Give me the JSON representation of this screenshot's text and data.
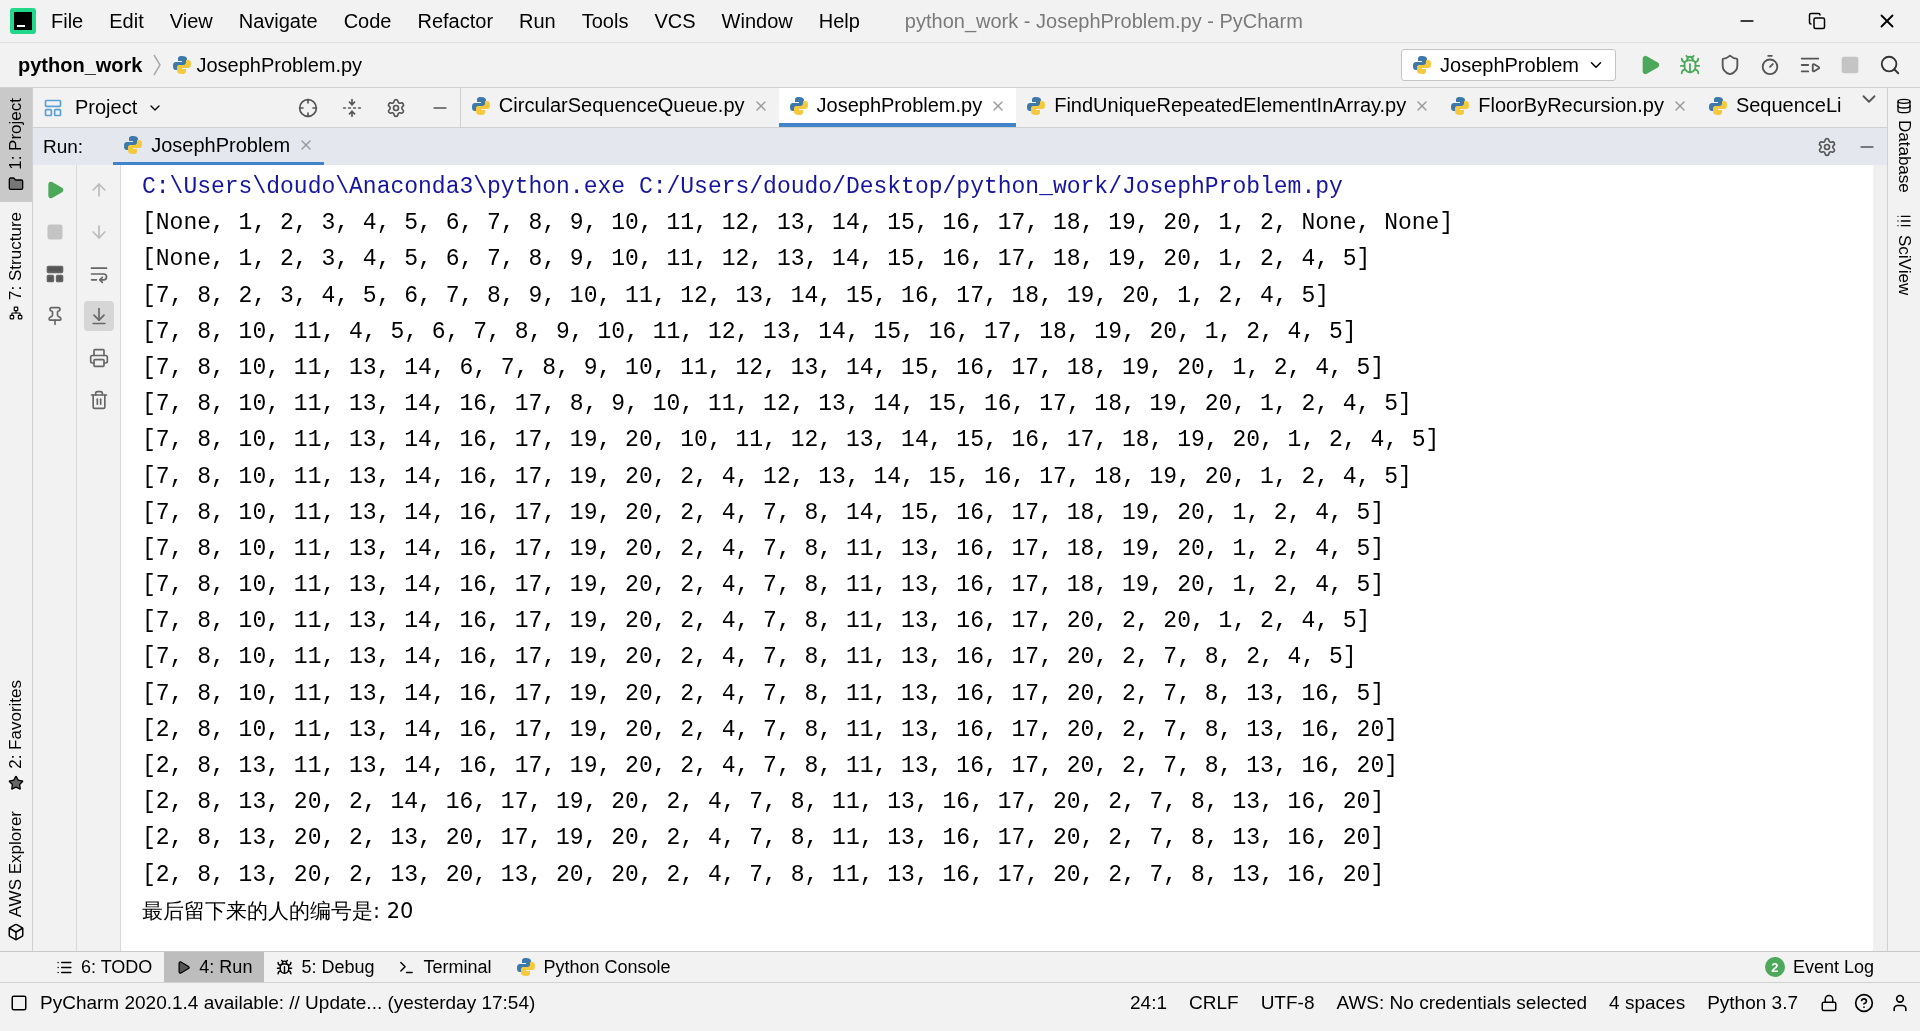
{
  "window": {
    "title": "python_work - JosephProblem.py - PyCharm"
  },
  "menu": [
    "File",
    "Edit",
    "View",
    "Navigate",
    "Code",
    "Refactor",
    "Run",
    "Tools",
    "VCS",
    "Window",
    "Help"
  ],
  "breadcrumb": {
    "project": "python_work",
    "file": "JosephProblem.py"
  },
  "run_config": {
    "label": "JosephProblem"
  },
  "project_panel": {
    "label": "Project"
  },
  "editor_tabs": [
    {
      "label": "CircularSequenceQueue.py",
      "selected": false
    },
    {
      "label": "JosephProblem.py",
      "selected": true
    },
    {
      "label": "FindUniqueRepeatedElementInArray.py",
      "selected": false
    },
    {
      "label": "FloorByRecursion.py",
      "selected": false
    },
    {
      "label": "SequenceLi",
      "selected": false
    }
  ],
  "left_stripe": {
    "top": [
      {
        "label": "1: Project",
        "selected": true
      },
      {
        "label": "7: Structure",
        "selected": false
      }
    ],
    "bottom": [
      {
        "label": "2: Favorites"
      },
      {
        "label": "AWS Explorer"
      }
    ]
  },
  "right_stripe": [
    {
      "label": "Database"
    },
    {
      "label": "SciView"
    }
  ],
  "run_panel": {
    "title": "Run:",
    "tab": "JosephProblem"
  },
  "console": [
    {
      "kind": "command",
      "text": "C:\\Users\\doudo\\Anaconda3\\python.exe C:/Users/doudo/Desktop/python_work/JosephProblem.py"
    },
    {
      "kind": "output",
      "text": "[None, 1, 2, 3, 4, 5, 6, 7, 8, 9, 10, 11, 12, 13, 14, 15, 16, 17, 18, 19, 20, 1, 2, None, None]"
    },
    {
      "kind": "output",
      "text": "[None, 1, 2, 3, 4, 5, 6, 7, 8, 9, 10, 11, 12, 13, 14, 15, 16, 17, 18, 19, 20, 1, 2, 4, 5]"
    },
    {
      "kind": "output",
      "text": "[7, 8, 2, 3, 4, 5, 6, 7, 8, 9, 10, 11, 12, 13, 14, 15, 16, 17, 18, 19, 20, 1, 2, 4, 5]"
    },
    {
      "kind": "output",
      "text": "[7, 8, 10, 11, 4, 5, 6, 7, 8, 9, 10, 11, 12, 13, 14, 15, 16, 17, 18, 19, 20, 1, 2, 4, 5]"
    },
    {
      "kind": "output",
      "text": "[7, 8, 10, 11, 13, 14, 6, 7, 8, 9, 10, 11, 12, 13, 14, 15, 16, 17, 18, 19, 20, 1, 2, 4, 5]"
    },
    {
      "kind": "output",
      "text": "[7, 8, 10, 11, 13, 14, 16, 17, 8, 9, 10, 11, 12, 13, 14, 15, 16, 17, 18, 19, 20, 1, 2, 4, 5]"
    },
    {
      "kind": "output",
      "text": "[7, 8, 10, 11, 13, 14, 16, 17, 19, 20, 10, 11, 12, 13, 14, 15, 16, 17, 18, 19, 20, 1, 2, 4, 5]"
    },
    {
      "kind": "output",
      "text": "[7, 8, 10, 11, 13, 14, 16, 17, 19, 20, 2, 4, 12, 13, 14, 15, 16, 17, 18, 19, 20, 1, 2, 4, 5]"
    },
    {
      "kind": "output",
      "text": "[7, 8, 10, 11, 13, 14, 16, 17, 19, 20, 2, 4, 7, 8, 14, 15, 16, 17, 18, 19, 20, 1, 2, 4, 5]"
    },
    {
      "kind": "output",
      "text": "[7, 8, 10, 11, 13, 14, 16, 17, 19, 20, 2, 4, 7, 8, 11, 13, 16, 17, 18, 19, 20, 1, 2, 4, 5]"
    },
    {
      "kind": "output",
      "text": "[7, 8, 10, 11, 13, 14, 16, 17, 19, 20, 2, 4, 7, 8, 11, 13, 16, 17, 18, 19, 20, 1, 2, 4, 5]"
    },
    {
      "kind": "output",
      "text": "[7, 8, 10, 11, 13, 14, 16, 17, 19, 20, 2, 4, 7, 8, 11, 13, 16, 17, 20, 2, 20, 1, 2, 4, 5]"
    },
    {
      "kind": "output",
      "text": "[7, 8, 10, 11, 13, 14, 16, 17, 19, 20, 2, 4, 7, 8, 11, 13, 16, 17, 20, 2, 7, 8, 2, 4, 5]"
    },
    {
      "kind": "output",
      "text": "[7, 8, 10, 11, 13, 14, 16, 17, 19, 20, 2, 4, 7, 8, 11, 13, 16, 17, 20, 2, 7, 8, 13, 16, 5]"
    },
    {
      "kind": "output",
      "text": "[2, 8, 10, 11, 13, 14, 16, 17, 19, 20, 2, 4, 7, 8, 11, 13, 16, 17, 20, 2, 7, 8, 13, 16, 20]"
    },
    {
      "kind": "output",
      "text": "[2, 8, 13, 11, 13, 14, 16, 17, 19, 20, 2, 4, 7, 8, 11, 13, 16, 17, 20, 2, 7, 8, 13, 16, 20]"
    },
    {
      "kind": "output",
      "text": "[2, 8, 13, 20, 2, 14, 16, 17, 19, 20, 2, 4, 7, 8, 11, 13, 16, 17, 20, 2, 7, 8, 13, 16, 20]"
    },
    {
      "kind": "output",
      "text": "[2, 8, 13, 20, 2, 13, 20, 17, 19, 20, 2, 4, 7, 8, 11, 13, 16, 17, 20, 2, 7, 8, 13, 16, 20]"
    },
    {
      "kind": "output",
      "text": "[2, 8, 13, 20, 2, 13, 20, 13, 20, 20, 2, 4, 7, 8, 11, 13, 16, 17, 20, 2, 7, 8, 13, 16, 20]"
    },
    {
      "kind": "output",
      "text": "最后留下来的人的编号是: 20"
    }
  ],
  "tool_tabs": [
    {
      "label": "6: TODO",
      "selected": false
    },
    {
      "label": "4: Run",
      "selected": true
    },
    {
      "label": "5: Debug",
      "selected": false
    },
    {
      "label": "Terminal",
      "selected": false
    },
    {
      "label": "Python Console",
      "selected": false
    }
  ],
  "event_log": {
    "count": "2",
    "label": "Event Log"
  },
  "status_bar": {
    "message": "PyCharm 2020.1.4 available: // Update... (yesterday 17:54)",
    "items": [
      "24:1",
      "CRLF",
      "UTF-8",
      "AWS: No credentials selected",
      "4 spaces",
      "Python 3.7"
    ]
  }
}
